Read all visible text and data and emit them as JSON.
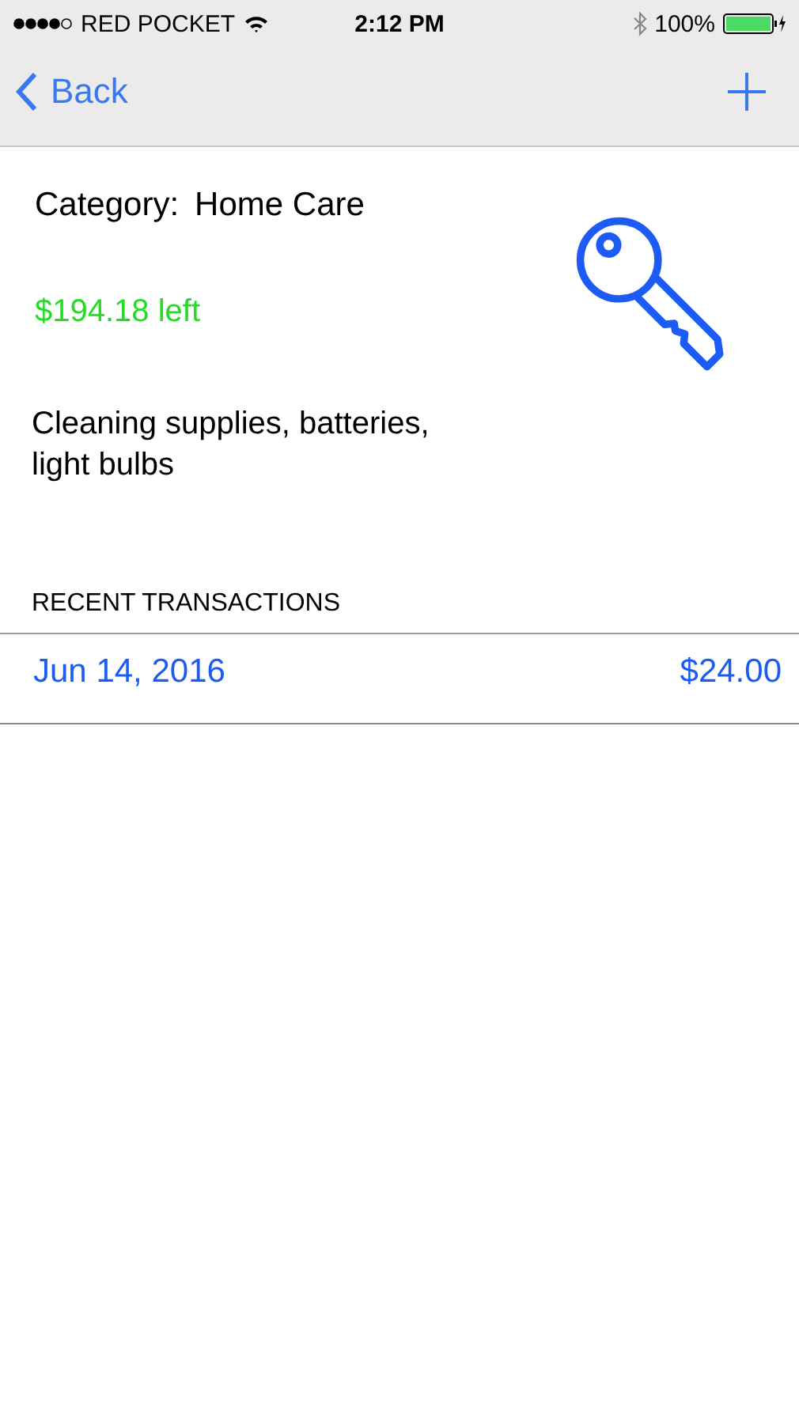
{
  "status_bar": {
    "carrier": "RED POCKET",
    "time": "2:12 PM",
    "battery": "100%"
  },
  "nav": {
    "back": "Back"
  },
  "category": {
    "label": "Category:",
    "value": "Home Care"
  },
  "remaining": "$194.18 left",
  "description": "Cleaning supplies, batteries, light bulbs",
  "section_title": "RECENT TRANSACTIONS",
  "transactions": [
    {
      "date": "Jun 14, 2016",
      "amount": "$24.00"
    }
  ]
}
